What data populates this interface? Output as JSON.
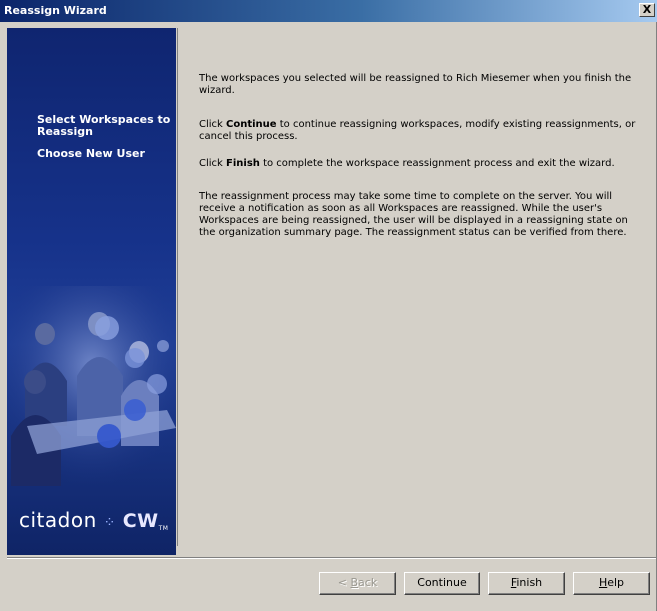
{
  "window": {
    "title": "Reassign Wizard",
    "close_label": "X"
  },
  "sidebar": {
    "steps": [
      "Select Workspaces to Reassign",
      "Choose New User"
    ],
    "logo": {
      "text": "citadon",
      "suffix": "CW",
      "tm": "TM"
    }
  },
  "content": {
    "p1": "The workspaces you selected will be reassigned to Rich Miesemer when you finish the wizard.",
    "p2_pre": "Click ",
    "p2_bold": "Continue",
    "p2_post": " to continue reassigning workspaces, modify existing reassignments, or cancel this process.",
    "p3_pre": "Click ",
    "p3_bold": "Finish",
    "p3_post": " to complete the workspace reassignment process and exit the wizard.",
    "p4": "The reassignment process may take some time to complete on the server. You will receive a notification as soon as all Workspaces are reassigned. While the user's Workspaces are being reassigned, the user will be displayed in a reassigning state on the organization summary page. The reassignment status can be verified from there."
  },
  "buttons": {
    "back": {
      "prefix": "< ",
      "mnemonic": "B",
      "rest": "ack"
    },
    "continue": "Continue",
    "finish": {
      "mnemonic": "F",
      "rest": "inish"
    },
    "help": {
      "mnemonic": "H",
      "rest": "elp"
    }
  }
}
